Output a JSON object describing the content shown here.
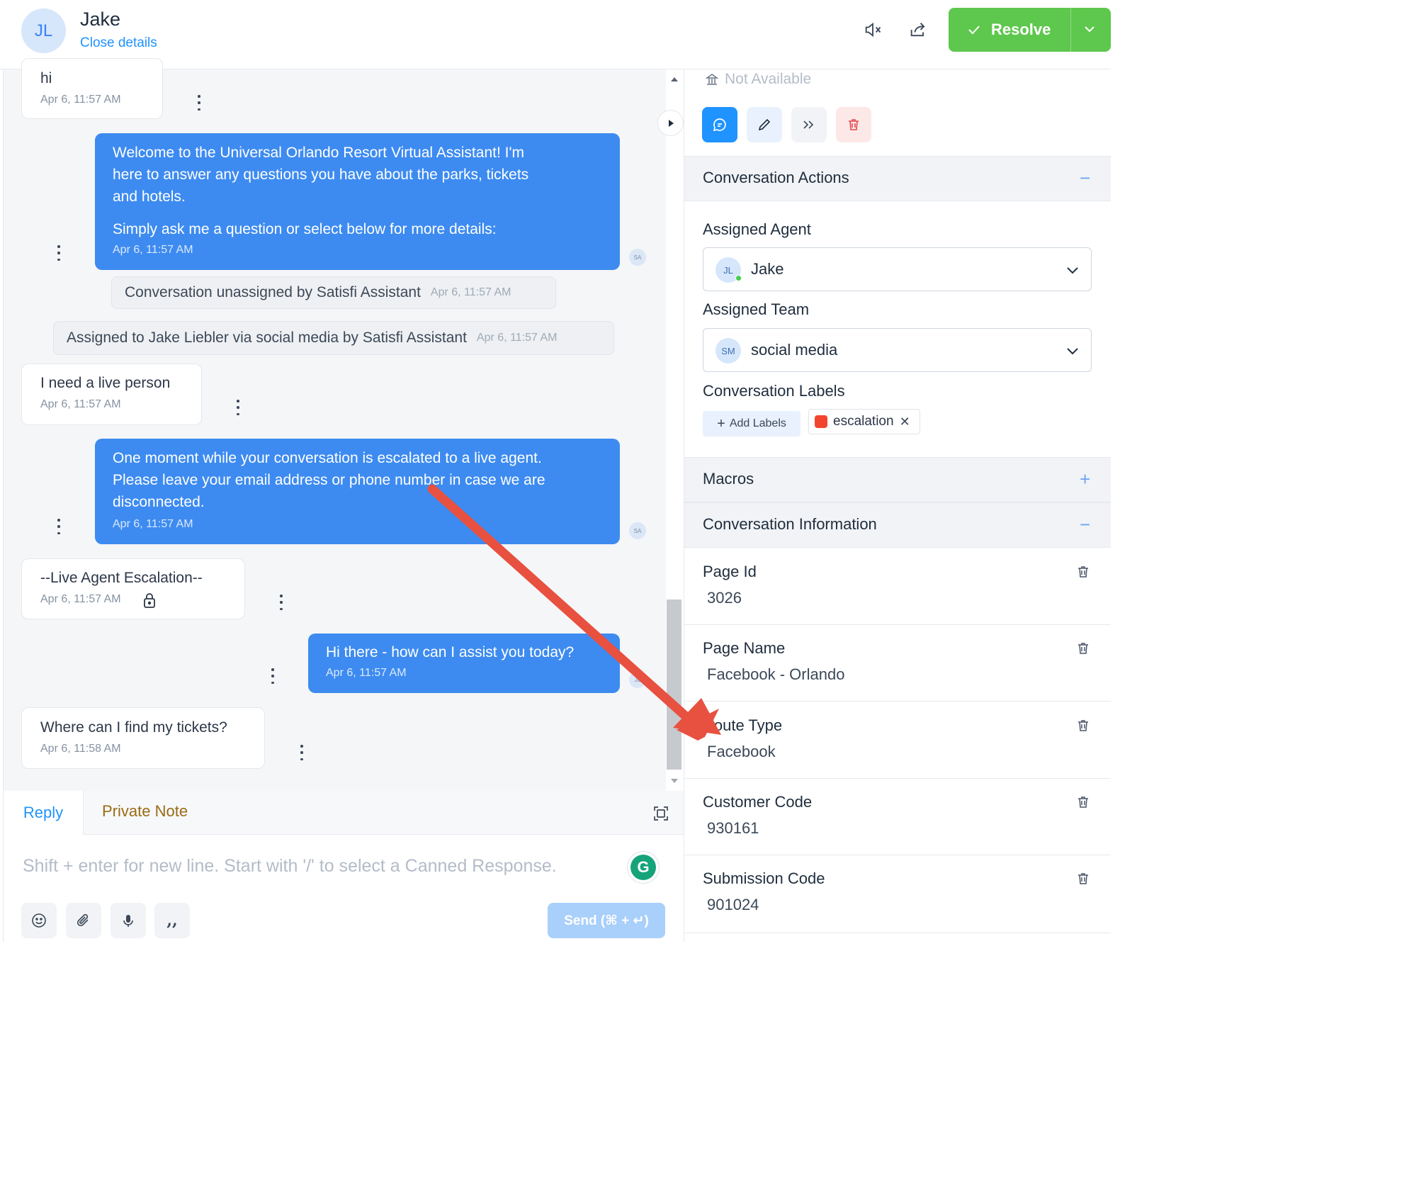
{
  "header": {
    "avatar_initials": "JL",
    "contact_name": "Jake",
    "close_details": "Close details",
    "resolve_label": "Resolve",
    "icons": [
      "mute-icon",
      "share-icon",
      "check-icon",
      "chevron-down-icon"
    ],
    "resolve_color": "#5ec74d"
  },
  "messages": [
    {
      "dir": "in",
      "text": "hi",
      "time": "Apr 6, 11:57 AM"
    },
    {
      "dir": "out",
      "lines": [
        "Welcome to the Universal Orlando Resort Virtual Assistant! I'm",
        "here to answer any questions you have about the parks, tickets",
        "and hotels.",
        "Simply ask me a question or select below for more details:"
      ],
      "time": "Apr 6, 11:57 AM",
      "sender": "SA"
    },
    {
      "dir": "activity",
      "text": "Conversation unassigned by Satisfi Assistant",
      "time": "Apr 6, 11:57 AM"
    },
    {
      "dir": "activity",
      "text": "Assigned to Jake Liebler via social media by Satisfi Assistant",
      "time": "Apr 6, 11:57 AM"
    },
    {
      "dir": "in",
      "text": "I need a live person",
      "time": "Apr 6, 11:57 AM"
    },
    {
      "dir": "out",
      "lines": [
        "One moment while your conversation is escalated to a live agent.",
        "Please leave your email address or phone number in case we are",
        "disconnected."
      ],
      "time": "Apr 6, 11:57 AM",
      "sender": "SA"
    },
    {
      "dir": "in",
      "text": "--Live Agent Escalation--",
      "time": "Apr 6, 11:57 AM"
    },
    {
      "dir": "out",
      "lines": [
        "Hi there - how can I assist you today?"
      ],
      "time": "Apr 6, 11:57 AM",
      "sender": "JL"
    },
    {
      "dir": "in",
      "text": "Where can I find my tickets?",
      "time": "Apr 6, 11:58 AM"
    }
  ],
  "reply": {
    "tab_reply": "Reply",
    "tab_private_note": "Private Note",
    "placeholder": "Shift + enter for new line. Start with '/' to select a Canned Response.",
    "send_label": "Send (⌘ + ↵)",
    "grammarly_letter": "G",
    "tools": [
      "emoji-icon",
      "attachment-icon",
      "microphone-icon",
      "quote-icon"
    ]
  },
  "sidebar": {
    "not_available": "Not Available",
    "conversation_actions": "Conversation Actions",
    "assigned_agent_label": "Assigned Agent",
    "assigned_agent": {
      "initials": "JL",
      "name": "Jake"
    },
    "assigned_team_label": "Assigned Team",
    "assigned_team": {
      "initials": "SM",
      "name": "social media"
    },
    "labels_heading": "Conversation Labels",
    "add_labels": "Add Labels",
    "labels": [
      {
        "name": "escalation",
        "color": "#f3452e"
      }
    ],
    "macros": "Macros",
    "conversation_information": "Conversation Information",
    "info": [
      {
        "key": "Page Id",
        "value": "3026"
      },
      {
        "key": "Page Name",
        "value": "Facebook - Orlando"
      },
      {
        "key": "Route Type",
        "value": "Facebook"
      },
      {
        "key": "Customer Code",
        "value": "930161"
      },
      {
        "key": "Submission Code",
        "value": "901024"
      }
    ],
    "section_signs": {
      "collapse": "−",
      "expand": "+"
    }
  },
  "annotation": {
    "arrow_color": "#e8503f"
  }
}
